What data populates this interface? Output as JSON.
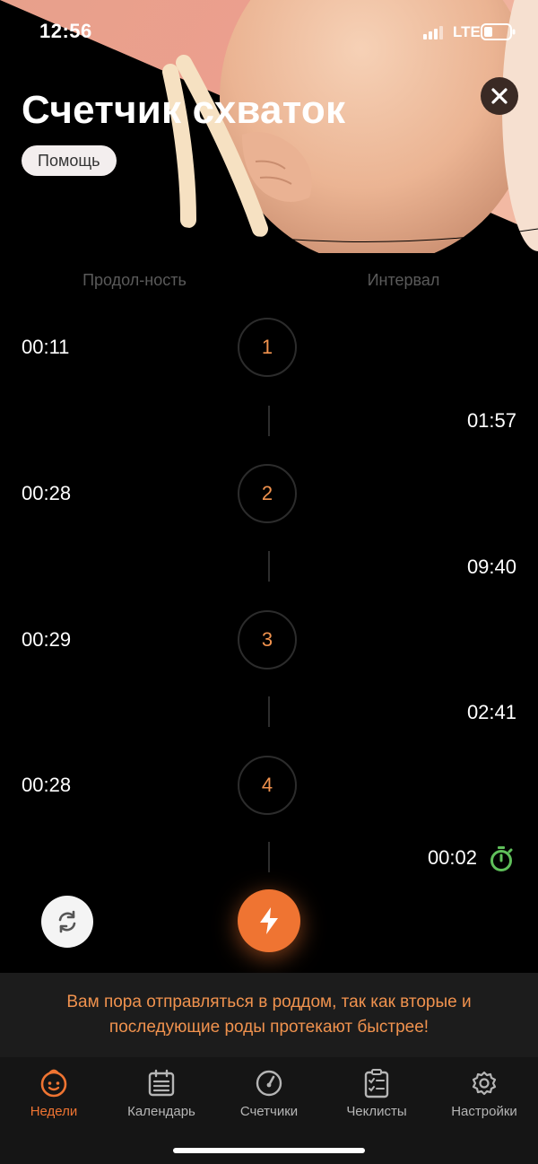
{
  "status_bar": {
    "time": "12:56",
    "network": "LTE",
    "icons": [
      "signal-icon",
      "battery-icon"
    ]
  },
  "header": {
    "title": "Счетчик схваток",
    "help_label": "Помощь",
    "close_icon": "close-icon"
  },
  "columns": {
    "duration_label": "Продол-ность",
    "interval_label": "Интервал"
  },
  "contractions": [
    {
      "number": "1",
      "duration": "00:11"
    },
    {
      "number": "2",
      "duration": "00:28"
    },
    {
      "number": "3",
      "duration": "00:29"
    },
    {
      "number": "4",
      "duration": "00:28"
    }
  ],
  "intervals": [
    "01:57",
    "09:40",
    "02:41",
    "00:02"
  ],
  "controls": {
    "refresh_icon": "refresh-icon",
    "contraction_icon": "lightning-icon",
    "timer_icon": "stopwatch-icon"
  },
  "notice": {
    "text": "Вам пора отправляться в роддом, так как вторые и последующие роды протекают быстрее!"
  },
  "tabs": [
    {
      "label": "Недели",
      "icon": "baby-face-icon",
      "active": true
    },
    {
      "label": "Календарь",
      "icon": "calendar-icon",
      "active": false
    },
    {
      "label": "Счетчики",
      "icon": "gauge-icon",
      "active": false
    },
    {
      "label": "Чеклисты",
      "icon": "checklist-icon",
      "active": false
    },
    {
      "label": "Настройки",
      "icon": "gear-icon",
      "active": false
    }
  ],
  "colors": {
    "accent": "#ef7432",
    "number": "#f0924e",
    "timer": "#5fbf5a",
    "background": "#000000"
  }
}
